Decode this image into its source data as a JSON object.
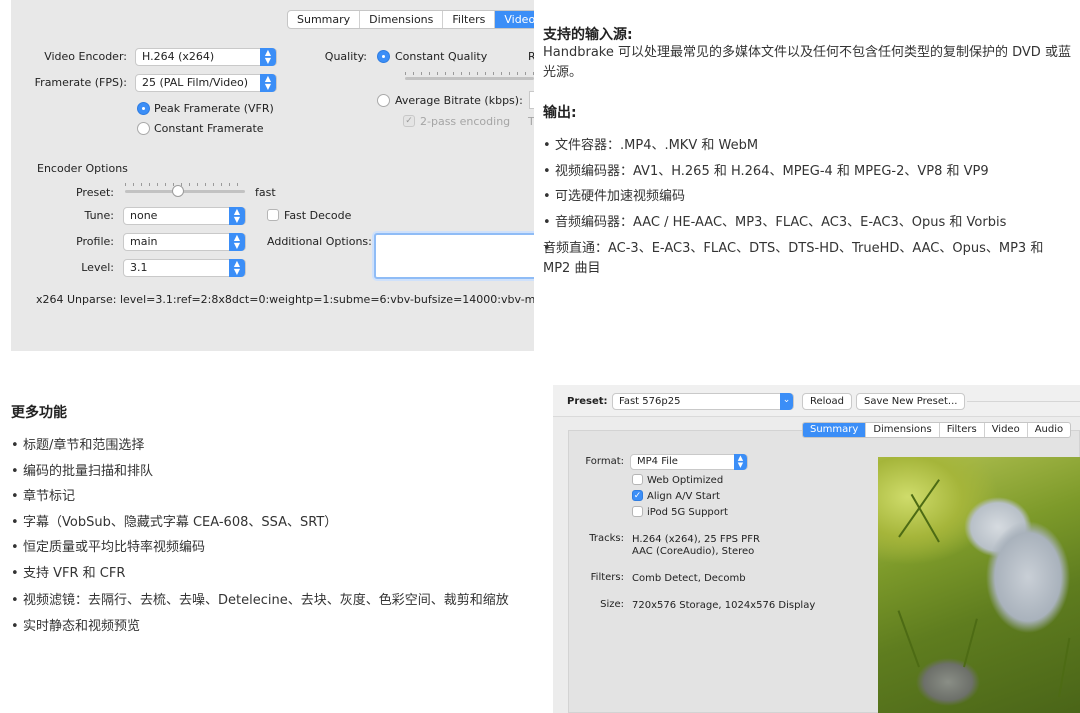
{
  "video_panel": {
    "tabs": [
      "Summary",
      "Dimensions",
      "Filters",
      "Video"
    ],
    "active_tab": "Video",
    "video_encoder_label": "Video Encoder:",
    "video_encoder_value": "H.264 (x264)",
    "framerate_label": "Framerate (FPS):",
    "framerate_value": "25 (PAL Film/Video)",
    "peak_framerate": "Peak Framerate (VFR)",
    "constant_framerate": "Constant Framerate",
    "quality_label": "Quality:",
    "constant_quality": "Constant Quality",
    "rf_partial": "R",
    "average_bitrate": "Average Bitrate (kbps):",
    "two_pass": "2-pass encoding",
    "turbo_partial": "T",
    "encoder_options_heading": "Encoder Options",
    "preset_label": "Preset:",
    "preset_value": "fast",
    "tune_label": "Tune:",
    "tune_value": "none",
    "fast_decode": "Fast Decode",
    "profile_label": "Profile:",
    "profile_value": "main",
    "additional_options_label": "Additional Options:",
    "level_label": "Level:",
    "level_value": "3.1",
    "x264_unparse": "x264 Unparse: level=3.1:ref=2:8x8dct=0:weightp=1:subme=6:vbv-bufsize=14000:vbv-maxrate"
  },
  "input_section": {
    "title": "支持的输入源:",
    "body": "Handbrake 可以处理最常见的多媒体文件以及任何不包含任何类型的复制保护的 DVD 或蓝光源。"
  },
  "output_section": {
    "title": "输出:",
    "items": [
      "文件容器：.MP4、.MKV 和 WebM",
      "视频编码器：AV1、H.265 和 H.264、MPEG-4 和 MPEG-2、VP8 和 VP9",
      "可选硬件加速视频编码",
      "音频编码器：AAC / HE-AAC、MP3、FLAC、AC3、E-AC3、Opus 和 Vorbis",
      "音频直通：AC-3、E-AC3、FLAC、DTS、DTS-HD、TrueHD、AAC、Opus、MP3 和 MP2 曲目"
    ]
  },
  "features_section": {
    "title": "更多功能",
    "items": [
      "标题/章节和范围选择",
      "编码的批量扫描和排队",
      "章节标记",
      "字幕（VobSub、隐藏式字幕 CEA-608、SSA、SRT）",
      "恒定质量或平均比特率视频编码",
      "支持 VFR 和 CFR",
      "视频滤镜：去隔行、去梳、去噪、Detelecine、去块、灰度、色彩空间、裁剪和缩放",
      "实时静态和视频预览"
    ]
  },
  "summary_panel": {
    "preset_label": "Preset:",
    "preset_value": "Fast 576p25",
    "reload": "Reload",
    "save_new_preset": "Save New Preset...",
    "tabs": [
      "Summary",
      "Dimensions",
      "Filters",
      "Video",
      "Audio"
    ],
    "active_tab": "Summary",
    "format_label": "Format:",
    "format_value": "MP4 File",
    "web_optimized": "Web Optimized",
    "align_av": "Align A/V Start",
    "ipod": "iPod 5G Support",
    "tracks_label": "Tracks:",
    "tracks_line1": "H.264 (x264), 25 FPS PFR",
    "tracks_line2": "AAC (CoreAudio), Stereo",
    "filters_label": "Filters:",
    "filters_value": "Comb Detect, Decomb",
    "size_label": "Size:",
    "size_value": "720x576 Storage, 1024x576 Display"
  },
  "colors": {
    "accent": "#3b8ef7"
  }
}
